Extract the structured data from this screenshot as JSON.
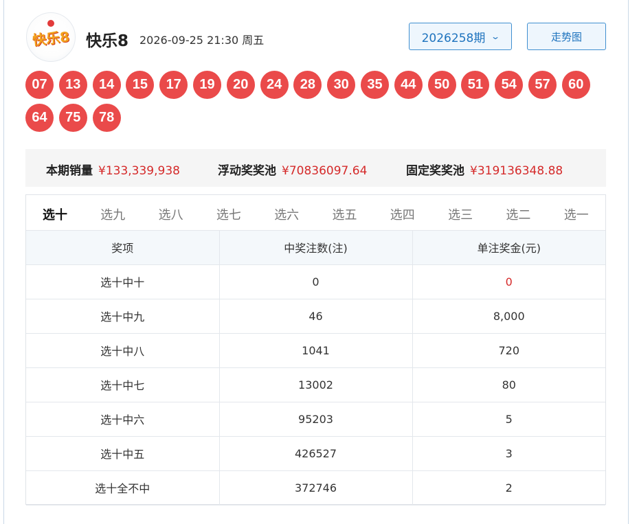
{
  "header": {
    "logo_text": "快乐8",
    "game_name": "快乐8",
    "draw_time": "2026-09-25 21:30 周五",
    "issue_label": "2026258期",
    "trend_button": "走势图"
  },
  "balls": [
    "07",
    "13",
    "14",
    "15",
    "17",
    "19",
    "20",
    "24",
    "28",
    "30",
    "35",
    "44",
    "50",
    "51",
    "54",
    "57",
    "60",
    "64",
    "75",
    "78"
  ],
  "stats": {
    "sales_label": "本期销量",
    "sales_value": "¥133,339,938",
    "float_pool_label": "浮动奖奖池",
    "float_pool_value": "¥70836097.64",
    "fixed_pool_label": "固定奖奖池",
    "fixed_pool_value": "¥319136348.88"
  },
  "tabs": [
    "选十",
    "选九",
    "选八",
    "选七",
    "选六",
    "选五",
    "选四",
    "选三",
    "选二",
    "选一"
  ],
  "table": {
    "headers": [
      "奖项",
      "中奖注数(注)",
      "单注奖金(元)"
    ],
    "rows": [
      [
        "选十中十",
        "0",
        "0"
      ],
      [
        "选十中九",
        "46",
        "8,000"
      ],
      [
        "选十中八",
        "1041",
        "720"
      ],
      [
        "选十中七",
        "13002",
        "80"
      ],
      [
        "选十中六",
        "95203",
        "5"
      ],
      [
        "选十中五",
        "426527",
        "3"
      ],
      [
        "选十全不中",
        "372746",
        "2"
      ]
    ]
  },
  "colors": {
    "ball": "#ea4a4a",
    "accent": "#1e73be",
    "money": "#d52a2a"
  }
}
